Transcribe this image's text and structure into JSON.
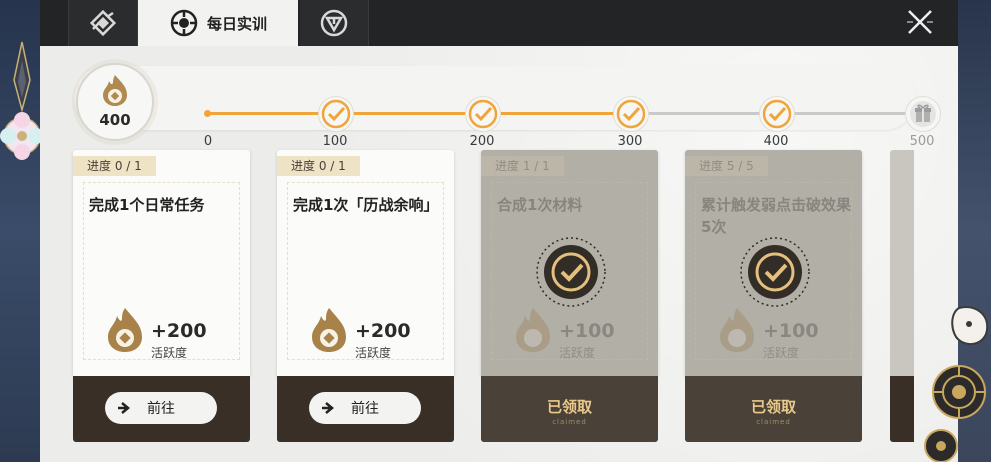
{
  "tabs": [
    {
      "icon": "diamond-knot-icon",
      "label": ""
    },
    {
      "icon": "sun-emblem-icon",
      "label": "每日实训"
    },
    {
      "icon": "triangle-emblem-icon",
      "label": ""
    }
  ],
  "activity": {
    "current_points": "400",
    "milestones": [
      {
        "label": "0",
        "done": true
      },
      {
        "label": "100",
        "done": true
      },
      {
        "label": "200",
        "done": true
      },
      {
        "label": "300",
        "done": true
      },
      {
        "label": "400",
        "done": true
      },
      {
        "label": "500",
        "done": false,
        "icon": "gift-icon"
      }
    ]
  },
  "colors": {
    "accent": "#f0a53a",
    "dark": "#3a2f26",
    "gold": "#e9c98a"
  },
  "cards": [
    {
      "progress": "进度  0 / 1",
      "title": "完成1个日常任务",
      "reward": "+200",
      "reward_label": "活跃度",
      "action": "前往",
      "claimed": false
    },
    {
      "progress": "进度  0 / 1",
      "title": "完成1次「历战余响」",
      "reward": "+200",
      "reward_label": "活跃度",
      "action": "前往",
      "claimed": false
    },
    {
      "progress": "进度  1 / 1",
      "title": "合成1次材料",
      "reward": "+100",
      "reward_label": "活跃度",
      "action": "已领取",
      "action_sub": "claimed",
      "claimed": true
    },
    {
      "progress": "进度  5 / 5",
      "title": "累计触发弱点击破效果5次",
      "reward": "+100",
      "reward_label": "活跃度",
      "action": "已领取",
      "action_sub": "claimed",
      "claimed": true
    }
  ]
}
